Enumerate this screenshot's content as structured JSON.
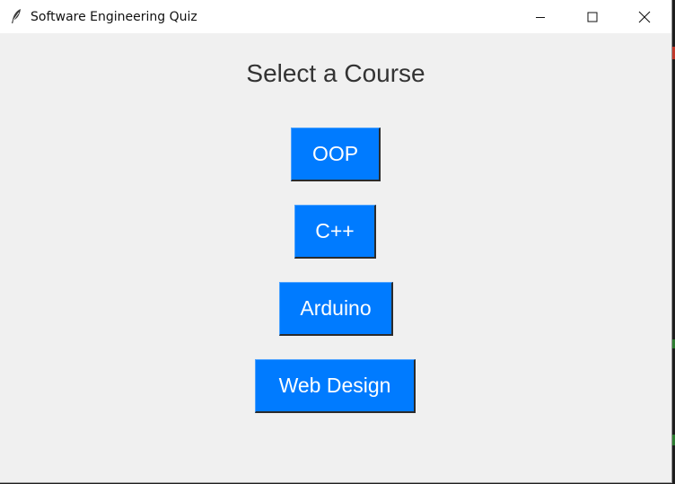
{
  "window": {
    "title": "Software Engineering Quiz",
    "app_icon": "feather-icon",
    "controls": {
      "minimize_icon": "minimize-icon",
      "maximize_icon": "maximize-icon",
      "close_icon": "close-icon"
    }
  },
  "main": {
    "heading": "Select a Course",
    "courses": [
      {
        "label": "OOP"
      },
      {
        "label": "C++"
      },
      {
        "label": "Arduino"
      },
      {
        "label": "Web Design"
      }
    ]
  },
  "colors": {
    "button_bg": "#007bff",
    "button_text": "#ffffff",
    "window_bg": "#f0f0f0",
    "heading_text": "#333333"
  }
}
